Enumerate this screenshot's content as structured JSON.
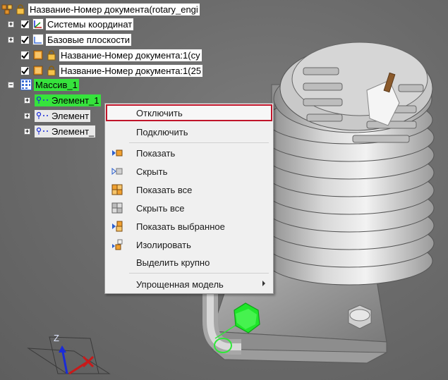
{
  "tree": {
    "root_label": "Название-Номер документа(rotary_engi",
    "items": [
      {
        "label": "Системы координат"
      },
      {
        "label": "Базовые плоскости"
      },
      {
        "label": "Название-Номер документа:1(су"
      },
      {
        "label": "Название-Номер документа:1(25"
      },
      {
        "label": "Массив_1"
      },
      {
        "label": "Элемент_1"
      },
      {
        "label": "Элемент"
      },
      {
        "label": "Элемент_"
      }
    ]
  },
  "context_menu": {
    "items": [
      {
        "label": "Отключить",
        "icon": "none",
        "selected": true
      },
      {
        "label": "Подключить",
        "icon": "none"
      },
      {
        "label": "Показать",
        "icon": "show-icon"
      },
      {
        "label": "Скрыть",
        "icon": "hide-icon"
      },
      {
        "label": "Показать все",
        "icon": "show-all-icon"
      },
      {
        "label": "Скрыть все",
        "icon": "hide-all-icon"
      },
      {
        "label": "Показать выбранное",
        "icon": "show-selected-icon"
      },
      {
        "label": "Изолировать",
        "icon": "isolate-icon"
      },
      {
        "label": "Выделить крупно",
        "icon": "none"
      },
      {
        "label": "Упрощенная модель",
        "icon": "none",
        "submenu": true
      }
    ]
  },
  "triad": {
    "z_label": "Z"
  },
  "colors": {
    "highlight": "#36e33c",
    "selection_border": "#c0142a",
    "menu_bg": "#f0f0f0"
  }
}
